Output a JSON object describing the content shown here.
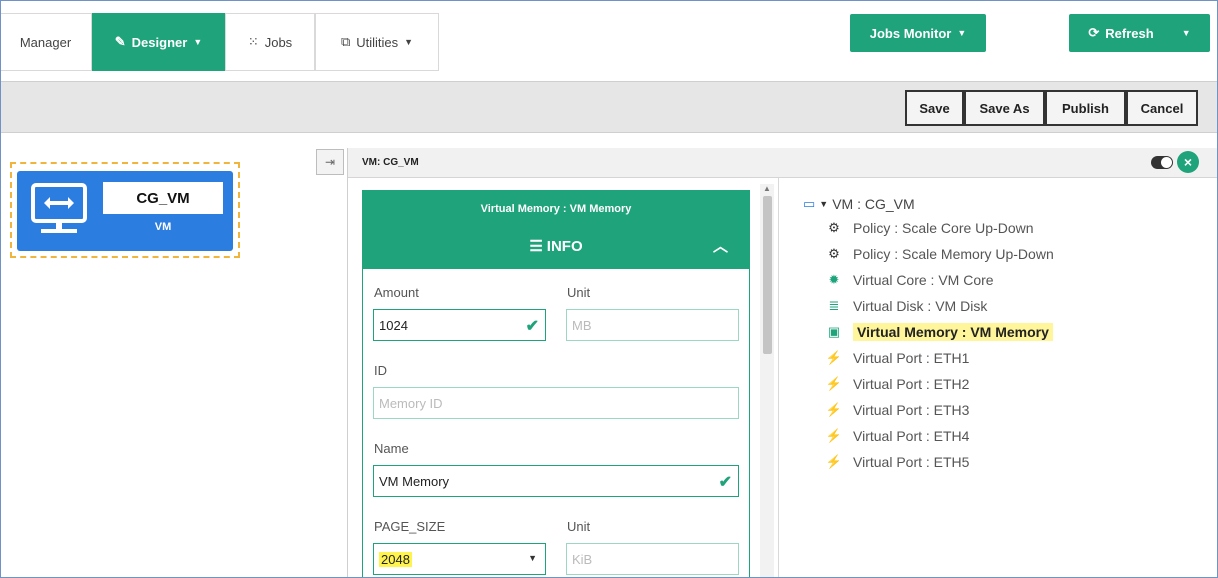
{
  "nav": {
    "tabs": [
      {
        "label": "Manager",
        "icon": "none"
      },
      {
        "label": "Designer",
        "icon": "edit-icon",
        "active": true
      },
      {
        "label": "Jobs",
        "icon": "spinner-icon"
      },
      {
        "label": "Utilities",
        "icon": "external-link-icon"
      }
    ],
    "jobs_monitor": "Jobs Monitor",
    "refresh": "Refresh"
  },
  "toolbar": {
    "save": "Save",
    "save_as": "Save As",
    "publish": "Publish",
    "cancel": "Cancel"
  },
  "canvas": {
    "node": {
      "name": "CG_VM",
      "type": "VM"
    }
  },
  "panel": {
    "title": "VM: CG_VM",
    "card": {
      "title": "Virtual Memory : VM Memory",
      "section": "INFO",
      "amount_label": "Amount",
      "amount_value": "1024",
      "unit_label": "Unit",
      "unit_placeholder": "MB",
      "id_label": "ID",
      "id_placeholder": "Memory ID",
      "name_label": "Name",
      "name_value": "VM Memory",
      "page_size_label": "PAGE_SIZE",
      "page_size_value": "2048",
      "unit2_label": "Unit",
      "unit2_placeholder": "KiB"
    },
    "tree": {
      "root": "VM : CG_VM",
      "items": [
        {
          "label": "Policy : Scale Core Up-Down",
          "icon": "cogs-icon"
        },
        {
          "label": "Policy : Scale Memory Up-Down",
          "icon": "cogs-icon"
        },
        {
          "label": "Virtual Core : VM Core",
          "icon": "gear-icon"
        },
        {
          "label": "Virtual Disk : VM Disk",
          "icon": "database-icon"
        },
        {
          "label": "Virtual Memory : VM Memory",
          "icon": "floppy-icon",
          "active": true
        },
        {
          "label": "Virtual Port : ETH1",
          "icon": "plug-icon"
        },
        {
          "label": "Virtual Port : ETH2",
          "icon": "plug-icon"
        },
        {
          "label": "Virtual Port : ETH3",
          "icon": "plug-icon"
        },
        {
          "label": "Virtual Port : ETH4",
          "icon": "plug-icon"
        },
        {
          "label": "Virtual Port : ETH5",
          "icon": "plug-icon"
        }
      ]
    }
  },
  "colors": {
    "accent": "#1fa37a",
    "node_blue": "#2b7de0",
    "highlight": "#fff34d",
    "selection_outline": "#f0b53a"
  }
}
